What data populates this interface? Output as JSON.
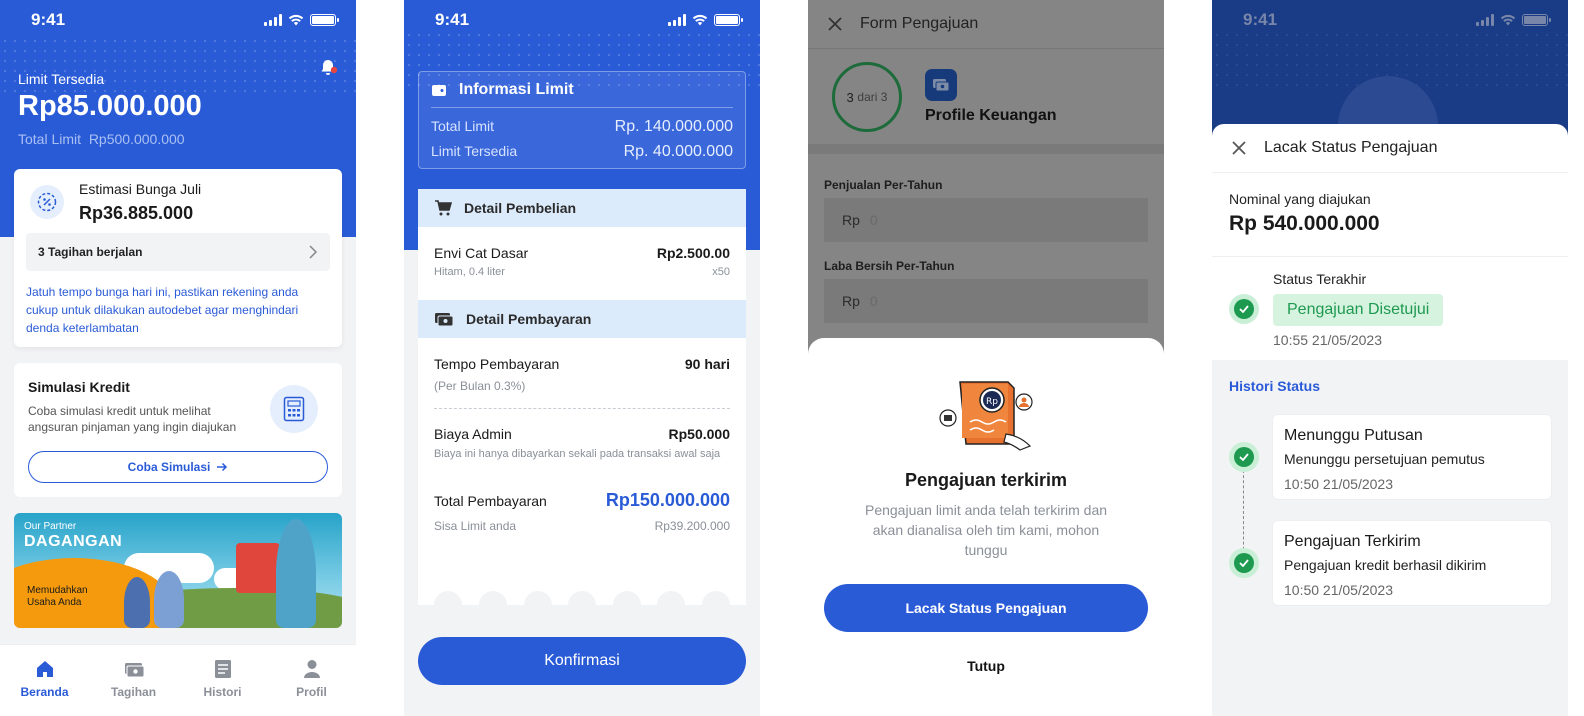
{
  "statusbar": {
    "time": "9:41"
  },
  "home": {
    "limit_label": "Limit Tersedia",
    "limit_value": "Rp85.000.000",
    "total_limit_label": "Total Limit",
    "total_limit_value": "Rp500.000.000",
    "estimation_label": "Estimasi Bunga Juli",
    "estimation_value": "Rp36.885.000",
    "bills_label": "3 Tagihan berjalan",
    "due_note": "Jatuh tempo bunga hari ini, pastikan rekening anda cukup untuk dilakukan autodebet agar menghindari denda keterlambatan",
    "simulation_title": "Simulasi Kredit",
    "simulation_desc": "Coba simulasi kredit untuk melihat angsuran pinjaman yang ingin diajukan",
    "simulation_button": "Coba Simulasi",
    "banner": {
      "partner": "Our Partner",
      "brand": "DAGANGAN",
      "tagline": "Memudahkan Usaha Anda"
    },
    "nav": [
      {
        "label": "Beranda",
        "icon": "home-icon",
        "active": true
      },
      {
        "label": "Tagihan",
        "icon": "bill-icon",
        "active": false
      },
      {
        "label": "Histori",
        "icon": "history-icon",
        "active": false
      },
      {
        "label": "Profil",
        "icon": "profile-icon",
        "active": false
      }
    ]
  },
  "purchase": {
    "info_title": "Informasi Limit",
    "total_limit_label": "Total Limit",
    "total_limit_value": "Rp. 140.000.000",
    "available_label": "Limit Tersedia",
    "available_value": "Rp. 40.000.000",
    "purchase_section": "Detail Pembelian",
    "item_name": "Envi Cat Dasar",
    "item_price": "Rp2.500.00",
    "item_variant": "Hitam, 0.4 liter",
    "item_qty": "x50",
    "payment_section": "Detail Pembayaran",
    "tenor_label": "Tempo Pembayaran",
    "tenor_value": "90 hari",
    "tenor_note": "(Per Bulan 0.3%)",
    "admin_label": "Biaya Admin",
    "admin_value": "Rp50.000",
    "admin_note": "Biaya ini hanya dibayarkan sekali pada transaksi awal saja",
    "total_label": "Total Pembayaran",
    "total_value": "Rp150.000.000",
    "remaining_label": "Sisa Limit anda",
    "remaining_value": "Rp39.200.000",
    "confirm_button": "Konfirmasi"
  },
  "form": {
    "title": "Form Pengajuan",
    "step_current": "3",
    "step_total": "dari 3",
    "section_title": "Profile Keuangan",
    "sales_label": "Penjualan Per-Tahun",
    "profit_label": "Laba Bersih Per-Tahun",
    "currency_prefix": "Rp",
    "input_placeholder": "0",
    "sheet_title": "Pengajuan terkirim",
    "sheet_desc": "Pengajuan limit anda telah terkirim dan akan dianalisa oleh tim kami, mohon tunggu",
    "track_button": "Lacak Status Pengajuan",
    "close_button": "Tutup",
    "illustration_label": "Rp"
  },
  "tracking": {
    "title": "Lacak Status Pengajuan",
    "nominal_label": "Nominal yang diajukan",
    "nominal_value": "Rp 540.000.000",
    "last_status_label": "Status Terakhir",
    "last_status": "Pengajuan Disetujui",
    "last_time": "10:55 21/05/2023",
    "history_title": "Histori Status",
    "history": [
      {
        "title": "Menunggu Putusan",
        "desc": "Menunggu persetujuan pemutus",
        "time": "10:50 21/05/2023"
      },
      {
        "title": "Pengajuan Terkirim",
        "desc": "Pengajuan kredit berhasil dikirim",
        "time": "10:50 21/05/2023"
      }
    ]
  },
  "colors": {
    "primary": "#2a5bd7",
    "success": "#1e9a50",
    "light_blue": "#dcebfb"
  }
}
